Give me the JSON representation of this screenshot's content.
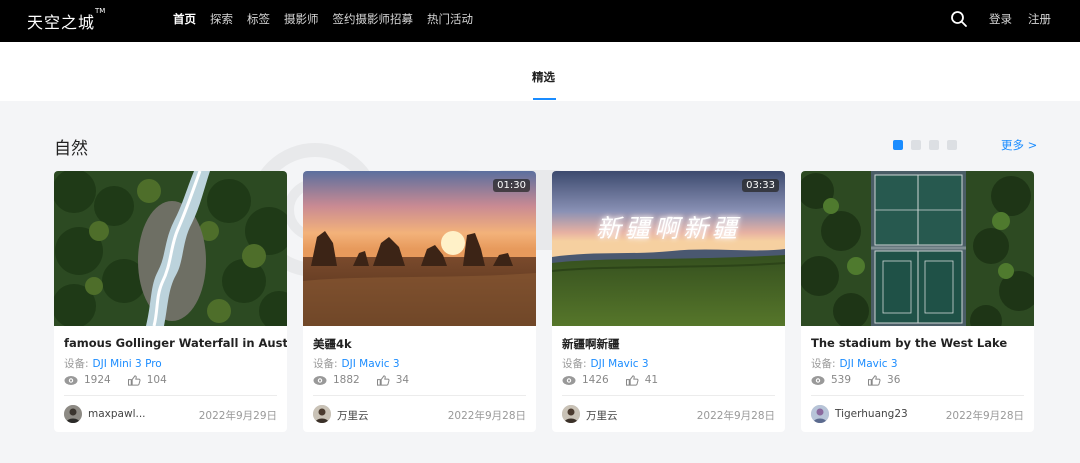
{
  "header": {
    "logo": "天空之城",
    "logo_tm": "TM",
    "nav": [
      {
        "label": "首页",
        "active": true
      },
      {
        "label": "探索",
        "active": false
      },
      {
        "label": "标签",
        "active": false
      },
      {
        "label": "摄影师",
        "active": false
      },
      {
        "label": "签约摄影师招募",
        "active": false
      },
      {
        "label": "热门活动",
        "active": false
      }
    ],
    "login": "登录",
    "register": "注册"
  },
  "tabs": {
    "featured": "精选"
  },
  "section": {
    "title": "自然",
    "more": "更多 >",
    "pager": {
      "total": 4,
      "active": 0
    }
  },
  "colors": {
    "accent": "#1a8cff",
    "topbar": "#000000",
    "background": "#f4f5f7"
  },
  "device_label": "设备:",
  "cards": [
    {
      "title": "famous Gollinger Waterfall in Austria",
      "device": "DJI Mini 3 Pro",
      "views": "1924",
      "likes": "104",
      "author": "maxpawl...",
      "date": "2022年9月29日",
      "duration": "",
      "thumb_caption": "",
      "thumb_scene": "forest-waterfall"
    },
    {
      "title": "美疆4k",
      "device": "DJI Mavic 3",
      "views": "1882",
      "likes": "34",
      "author": "万里云",
      "date": "2022年9月28日",
      "duration": "01:30",
      "thumb_caption": "",
      "thumb_scene": "sunset-rocks"
    },
    {
      "title": "新疆啊新疆",
      "device": "DJI Mavic 3",
      "views": "1426",
      "likes": "41",
      "author": "万里云",
      "date": "2022年9月28日",
      "duration": "03:33",
      "thumb_caption": "新疆啊新疆",
      "thumb_scene": "grassland-dusk"
    },
    {
      "title": "The stadium by the West Lake",
      "device": "DJI Mavic 3",
      "views": "539",
      "likes": "36",
      "author": "Tigerhuang23",
      "date": "2022年9月28日",
      "duration": "",
      "thumb_caption": "",
      "thumb_scene": "aerial-courts"
    }
  ]
}
